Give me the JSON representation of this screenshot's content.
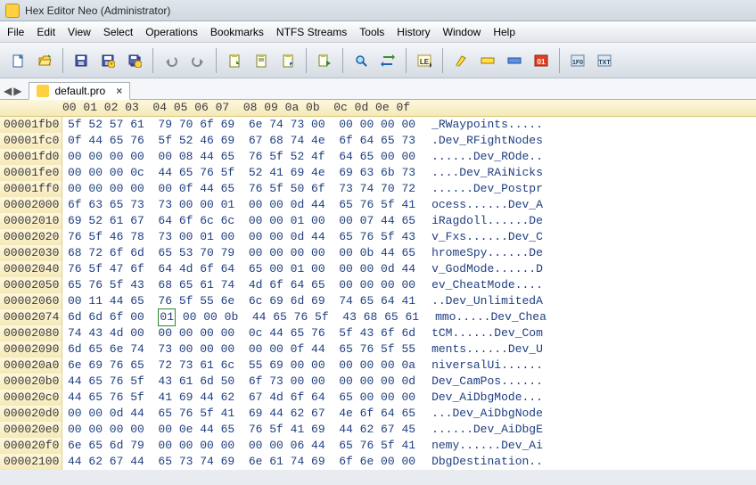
{
  "window": {
    "title": "Hex Editor Neo (Administrator)"
  },
  "menubar": [
    "File",
    "Edit",
    "View",
    "Select",
    "Operations",
    "Bookmarks",
    "NTFS Streams",
    "Tools",
    "History",
    "Window",
    "Help"
  ],
  "toolbar_icons": [
    {
      "name": "new-icon",
      "svg": "<rect x='3' y='2' width='10' height='13' fill='#fff' stroke='#3060a0'/><path d='M10 2 L13 5 L10 5 Z' fill='#b0d0f0' stroke='#3060a0'/>",
      "sep": false
    },
    {
      "name": "open-icon",
      "svg": "<path d='M2 5 L6 5 L7 3 L14 3 L14 13 L2 13 Z' fill='#ffd850' stroke='#a07810'/><path d='M4 7 L15 7 L13 13 L2 13 Z' fill='#ffe880' stroke='#a07810'/><polygon points='12,1 15,4 12,4' fill='#4a9040'/>",
      "sep": true
    },
    {
      "name": "save-icon",
      "svg": "<rect x='2' y='2' width='12' height='12' fill='#4a5aa0' stroke='#20307a'/><rect x='4' y='3' width='8' height='4' fill='#fff'/><rect x='5' y='9' width='6' height='4' fill='#c0c8e0'/>",
      "sep": false
    },
    {
      "name": "save-as-icon",
      "svg": "<rect x='2' y='2' width='12' height='12' fill='#4a5aa0' stroke='#20307a'/><rect x='4' y='3' width='8' height='4' fill='#fff'/><rect x='5' y='9' width='6' height='4' fill='#c0c8e0'/><circle cx='12' cy='12' r='4' fill='#ffd040' stroke='#a07810'/><text x='12' y='15' font-size='7' text-anchor='middle' fill='#604000'>*</text>",
      "sep": false
    },
    {
      "name": "save-all-icon",
      "svg": "<rect x='4' y='4' width='10' height='10' fill='#4a5aa0' stroke='#20307a'/><rect x='2' y='2' width='10' height='10' fill='#5a6ab0' stroke='#20307a'/><rect x='4' y='3' width='6' height='3' fill='#fff'/><circle cx='12' cy='12' r='4' fill='#ffd040' stroke='#a07810'/>",
      "sep": true
    },
    {
      "name": "undo-icon",
      "svg": "<path d='M12 5 A5 5 0 1 1 4 9' fill='none' stroke='#808890' stroke-width='2'/><polygon points='2,9 6,6 6,12' fill='#808890'/>",
      "sep": false
    },
    {
      "name": "redo-icon",
      "svg": "<path d='M4 5 A5 5 0 1 0 12 9' fill='none' stroke='#808890' stroke-width='2'/><polygon points='14,9 10,6 10,12' fill='#808890'/>",
      "sep": true
    },
    {
      "name": "clipboard-1-icon",
      "svg": "<rect x='3' y='2' width='10' height='13' fill='#fffef0' stroke='#808020'/><rect x='5' y='1' width='6' height='3' fill='#c0c060'/><polygon points='10,8 14,12 10,12' fill='#3a9030'/>",
      "sep": false
    },
    {
      "name": "clipboard-2-icon",
      "svg": "<rect x='3' y='2' width='10' height='13' fill='#fffef0' stroke='#808020'/><rect x='5' y='1' width='6' height='3' fill='#c0c060'/><line x1='5' y1='6' x2='11' y2='6' stroke='#606040'/><line x1='5' y1='8' x2='11' y2='8' stroke='#606040'/>",
      "sep": false
    },
    {
      "name": "clipboard-3-icon",
      "svg": "<rect x='3' y='2' width='10' height='13' fill='#fffef0' stroke='#808020'/><rect x='5' y='1' width='6' height='3' fill='#c0c060'/><polygon points='14,10 10,14 10,10' fill='#3060c0'/>",
      "sep": true
    },
    {
      "name": "clipboard-go-icon",
      "svg": "<rect x='2' y='2' width='9' height='12' fill='#fffef0' stroke='#808020'/><rect x='4' y='1' width='5' height='3' fill='#c0c060'/><polygon points='10,8 15,11 10,14' fill='#2a8a2a'/>",
      "sep": true
    },
    {
      "name": "find-icon",
      "svg": "<circle cx='7' cy='7' r='4' fill='#b0e0ff' stroke='#2060a0' stroke-width='1.5'/><line x1='10' y1='10' x2='14' y2='14' stroke='#2060a0' stroke-width='2'/>",
      "sep": false
    },
    {
      "name": "replace-icon",
      "svg": "<path d='M3 4 L13 4' stroke='#3a9030' stroke-width='2'/><polygon points='13,1 13,7 16,4' fill='#3a9030'/><path d='M13 12 L3 12' stroke='#2060c0' stroke-width='2'/><polygon points='3,9 3,15 0,12' fill='#2060c0'/>",
      "sep": true
    },
    {
      "name": "le-icon",
      "svg": "<rect x='1' y='2' width='14' height='12' fill='#fffde0' stroke='#b09030'/><text x='8' y='12' font-size='8' text-anchor='middle' fill='#303030' font-family='sans-serif' font-weight='bold'>LE</text><polygon points='14,10 14,16 17,13' fill='#404040'/>",
      "sep": true
    },
    {
      "name": "highlight-icon",
      "svg": "<path d='M3 13 L9 3 L13 5 L6 14 Z' fill='#ffe040' stroke='#a07810'/><path d='M2 15 L4 12 L6 14 Z' fill='#90e060'/>",
      "sep": false
    },
    {
      "name": "bar-yellow-icon",
      "svg": "<rect x='1' y='5' width='14' height='6' fill='#ffe040' stroke='#a07810'/>",
      "sep": false
    },
    {
      "name": "bar-blue-icon",
      "svg": "<rect x='1' y='5' width='14' height='6' fill='#6090e0' stroke='#2050a0'/>",
      "sep": false
    },
    {
      "name": "zero-one-icon",
      "svg": "<rect x='1' y='2' width='14' height='12' fill='#e04020' stroke='#902010'/><text x='8' y='12' font-size='8' text-anchor='middle' fill='#fff' font-family='sans-serif' font-weight='bold'>01</text>",
      "sep": true
    },
    {
      "name": "hex-icon",
      "svg": "<rect x='1' y='2' width='14' height='12' fill='#d8e8f4' stroke='#6080a0'/><text x='8' y='12' font-size='7' text-anchor='middle' fill='#304050' font-family='sans-serif' font-weight='bold'>1F0</text>",
      "sep": false
    },
    {
      "name": "txt-icon",
      "svg": "<rect x='1' y='2' width='14' height='12' fill='#d8e8f4' stroke='#6080a0'/><text x='8' y='12' font-size='7' text-anchor='middle' fill='#304050' font-family='sans-serif' font-weight='bold'>TXT</text>",
      "sep": false
    }
  ],
  "tab": {
    "label": "default.pro"
  },
  "hex": {
    "column_header": "00 01 02 03  04 05 06 07  08 09 0a 0b  0c 0d 0e 0f",
    "rows": [
      {
        "offset": "00001fb0",
        "bytes": "5f 52 57 61  79 70 6f 69  6e 74 73 00  00 00 00 00",
        "ascii": "_RWaypoints....."
      },
      {
        "offset": "00001fc0",
        "bytes": "0f 44 65 76  5f 52 46 69  67 68 74 4e  6f 64 65 73",
        "ascii": ".Dev_RFightNodes"
      },
      {
        "offset": "00001fd0",
        "bytes": "00 00 00 00  00 08 44 65  76 5f 52 4f  64 65 00 00",
        "ascii": "......Dev_ROde.."
      },
      {
        "offset": "00001fe0",
        "bytes": "00 00 00 0c  44 65 76 5f  52 41 69 4e  69 63 6b 73",
        "ascii": "....Dev_RAiNicks"
      },
      {
        "offset": "00001ff0",
        "bytes": "00 00 00 00  00 0f 44 65  76 5f 50 6f  73 74 70 72",
        "ascii": "......Dev_Postpr"
      },
      {
        "offset": "00002000",
        "bytes": "6f 63 65 73  73 00 00 01  00 00 0d 44  65 76 5f 41",
        "ascii": "ocess......Dev_A"
      },
      {
        "offset": "00002010",
        "bytes": "69 52 61 67  64 6f 6c 6c  00 00 01 00  00 07 44 65",
        "ascii": "iRagdoll......De"
      },
      {
        "offset": "00002020",
        "bytes": "76 5f 46 78  73 00 01 00  00 00 0d 44  65 76 5f 43",
        "ascii": "v_Fxs......Dev_C"
      },
      {
        "offset": "00002030",
        "bytes": "68 72 6f 6d  65 53 70 79  00 00 00 00  00 0b 44 65",
        "ascii": "hromeSpy......De"
      },
      {
        "offset": "00002040",
        "bytes": "76 5f 47 6f  64 4d 6f 64  65 00 01 00  00 00 0d 44",
        "ascii": "v_GodMode......D"
      },
      {
        "offset": "00002050",
        "bytes": "65 76 5f 43  68 65 61 74  4d 6f 64 65  00 00 00 00",
        "ascii": "ev_CheatMode...."
      },
      {
        "offset": "00002060",
        "bytes": "00 11 44 65  76 5f 55 6e  6c 69 6d 69  74 65 64 41",
        "ascii": "..Dev_UnlimitedA"
      },
      {
        "offset": "00002074",
        "bytes": "6d 6d 6f 00  01 00 00 0b  44 65 76 5f  43 68 65 61",
        "ascii": "mmo.....Dev_Chea",
        "selcol": 4
      },
      {
        "offset": "00002080",
        "bytes": "74 43 4d 00  00 00 00 00  0c 44 65 76  5f 43 6f 6d",
        "ascii": "tCM......Dev_Com"
      },
      {
        "offset": "00002090",
        "bytes": "6d 65 6e 74  73 00 00 00  00 00 0f 44  65 76 5f 55",
        "ascii": "ments......Dev_U"
      },
      {
        "offset": "000020a0",
        "bytes": "6e 69 76 65  72 73 61 6c  55 69 00 00  00 00 00 0a",
        "ascii": "niversalUi......"
      },
      {
        "offset": "000020b0",
        "bytes": "44 65 76 5f  43 61 6d 50  6f 73 00 00  00 00 00 0d",
        "ascii": "Dev_CamPos......"
      },
      {
        "offset": "000020c0",
        "bytes": "44 65 76 5f  41 69 44 62  67 4d 6f 64  65 00 00 00",
        "ascii": "Dev_AiDbgMode..."
      },
      {
        "offset": "000020d0",
        "bytes": "00 00 0d 44  65 76 5f 41  69 44 62 67  4e 6f 64 65",
        "ascii": "...Dev_AiDbgNode"
      },
      {
        "offset": "000020e0",
        "bytes": "00 00 00 00  00 0e 44 65  76 5f 41 69  44 62 67 45",
        "ascii": "......Dev_AiDbgE"
      },
      {
        "offset": "000020f0",
        "bytes": "6e 65 6d 79  00 00 00 00  00 00 06 44  65 76 5f 41",
        "ascii": "nemy......Dev_Ai"
      },
      {
        "offset": "00002100",
        "bytes": "44 62 67 44  65 73 74 69  6e 61 74 69  6f 6e 00 00",
        "ascii": "DbgDestination.."
      }
    ]
  }
}
